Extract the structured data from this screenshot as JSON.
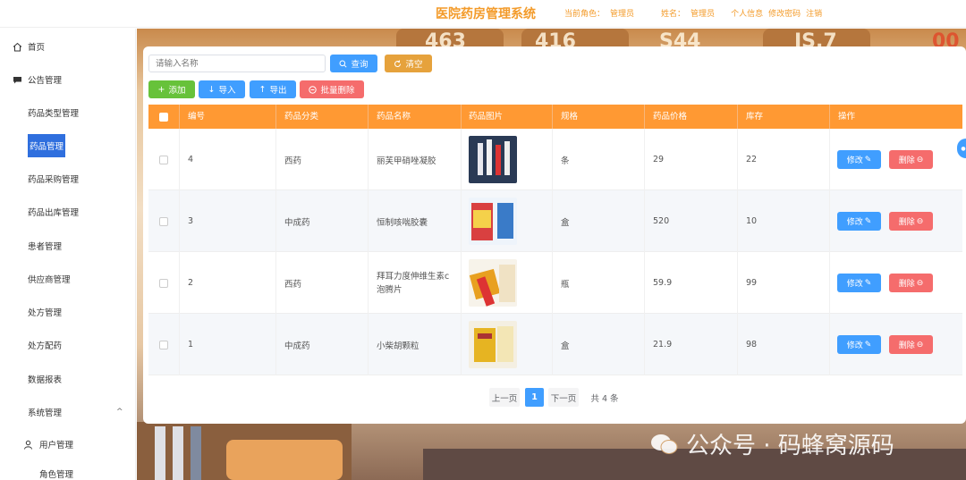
{
  "header": {
    "app_title": "医院药房管理系统",
    "role_label": "当前角色：",
    "role_value": "管理员",
    "name_label": "姓名：",
    "name_value": "管理员",
    "profile_link": "个人信息",
    "password_link": "修改密码",
    "logout_link": "注销"
  },
  "sidebar": {
    "items": [
      {
        "label": "首页",
        "icon": "home-icon"
      },
      {
        "label": "公告管理",
        "icon": "chat-icon"
      },
      {
        "label": "药品类型管理",
        "icon": "grid-icon"
      },
      {
        "label": "药品管理",
        "icon": "grid-icon",
        "active": true
      },
      {
        "label": "药品采购管理",
        "icon": "grid-icon"
      },
      {
        "label": "药品出库管理",
        "icon": "grid-icon"
      },
      {
        "label": "患者管理",
        "icon": "grid-icon"
      },
      {
        "label": "供应商管理",
        "icon": "grid-icon"
      },
      {
        "label": "处方管理",
        "icon": "grid-icon"
      },
      {
        "label": "处方配药",
        "icon": "grid-icon"
      },
      {
        "label": "数据报表",
        "icon": "grid-icon"
      },
      {
        "label": "系统管理",
        "icon": "menu-icon"
      }
    ],
    "sub_items": [
      {
        "label": "用户管理",
        "icon": "user-icon"
      },
      {
        "label": "角色管理",
        "icon": "grid-icon"
      }
    ],
    "active_color": "#2f6fde"
  },
  "toolbar": {
    "search_placeholder": "请输入名称",
    "search_label": "查询",
    "clear_label": "清空",
    "add_label": "添加",
    "import_label": "导入",
    "export_label": "导出",
    "batch_delete_label": "批量删除"
  },
  "table": {
    "columns": [
      "编号",
      "药品分类",
      "药品名称",
      "药品图片",
      "规格",
      "药品价格",
      "库存",
      "操作"
    ],
    "rows": [
      {
        "id": "4",
        "category": "西药",
        "name": "丽芙甲硝唑凝胶",
        "unit": "条",
        "price": "29",
        "stock": "22"
      },
      {
        "id": "3",
        "category": "中成药",
        "name": "恒制咳喘胶囊",
        "unit": "盒",
        "price": "520",
        "stock": "10"
      },
      {
        "id": "2",
        "category": "西药",
        "name": "拜耳力度伸维生素c泡腾片",
        "unit": "瓶",
        "price": "59.9",
        "stock": "99"
      },
      {
        "id": "1",
        "category": "中成药",
        "name": "小柴胡颗粒",
        "unit": "盒",
        "price": "21.9",
        "stock": "98"
      }
    ],
    "edit_label": "修改",
    "delete_label": "删除",
    "header_color": "#ff9933"
  },
  "pagination": {
    "prev_label": "上一页",
    "current_page": "1",
    "next_label": "下一页",
    "total_label": "共 4 条"
  },
  "background_numbers": [
    "463",
    "416",
    "S44",
    "IS.7",
    "00"
  ],
  "watermark": {
    "text": "公众号 · 码蜂窝源码"
  },
  "colors": {
    "accent": "#f39b2a",
    "primary": "#409eff",
    "success": "#67c23a",
    "danger": "#f56c6c",
    "warning": "#e6a23c"
  }
}
